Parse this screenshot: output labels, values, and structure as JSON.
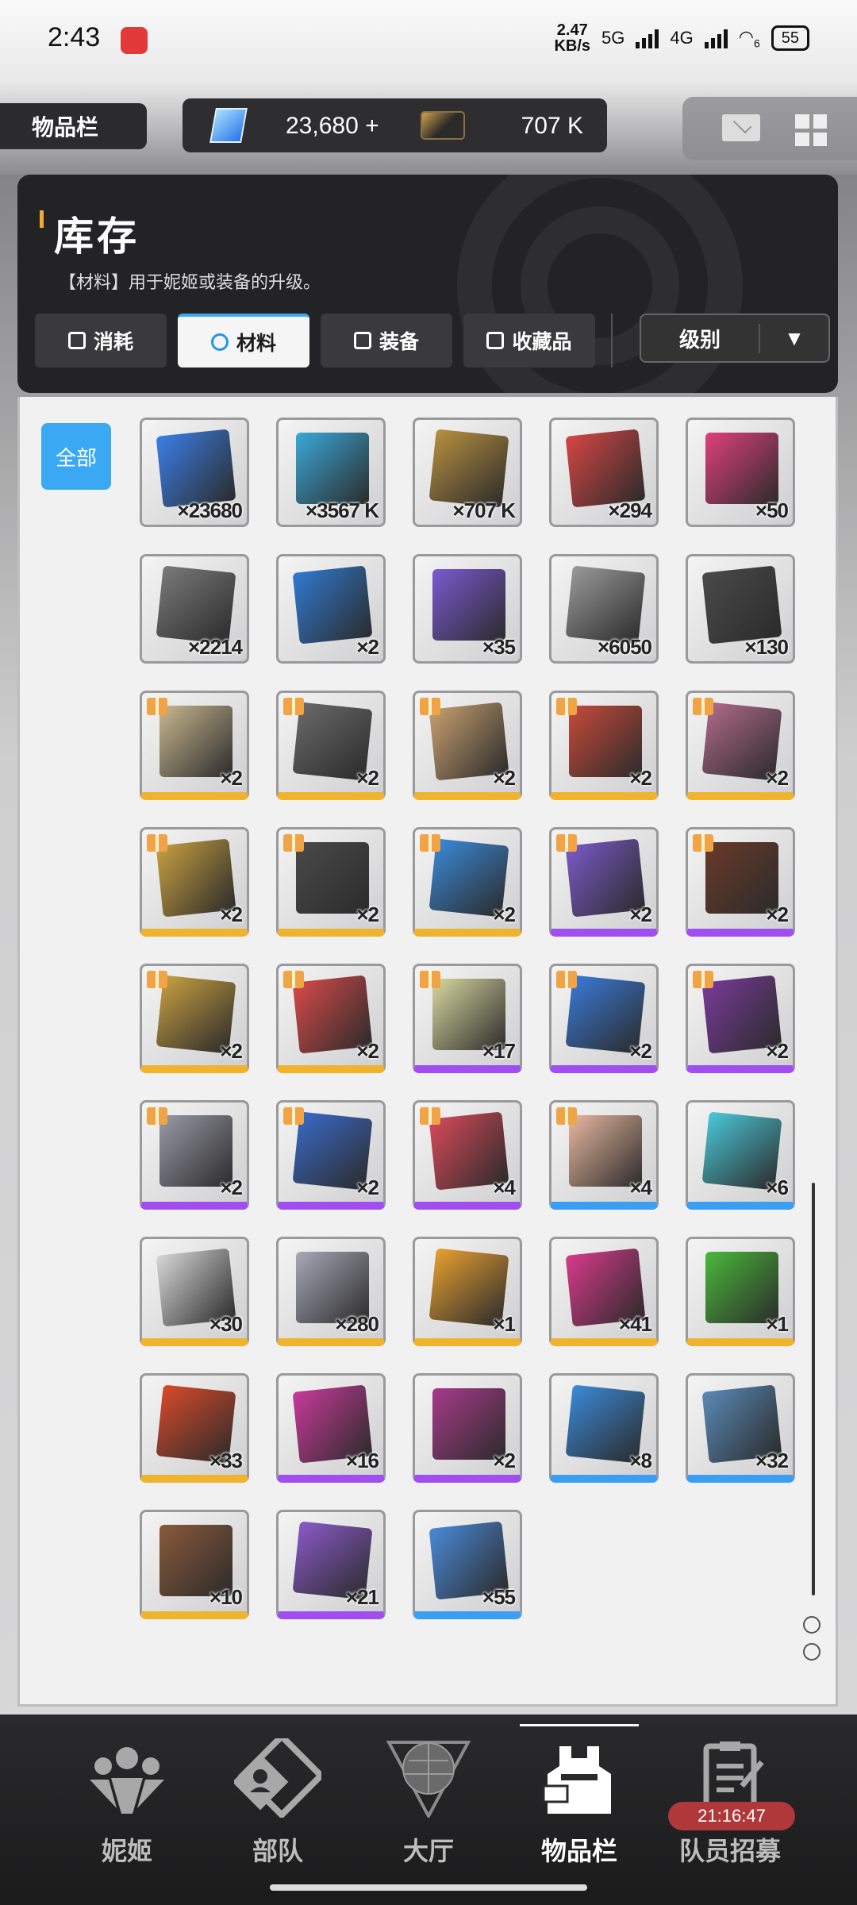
{
  "status_bar": {
    "time": "2:43",
    "speed": "2.47",
    "speed_unit": "KB/s",
    "net1": "5G",
    "net2": "4G",
    "wifi_label": "6",
    "battery": "55"
  },
  "header": {
    "page_tab": "物品栏",
    "currency": {
      "gems": "23,680",
      "gems_add": "+",
      "credits": "707 K"
    },
    "icons": [
      "mail-icon",
      "grid-menu-icon"
    ]
  },
  "panel": {
    "title": "库存",
    "description": "【材料】用于妮姬或装备的升级。",
    "tabs": [
      {
        "label": "消耗",
        "icon": "consumable-icon"
      },
      {
        "label": "材料",
        "icon": "material-icon"
      },
      {
        "label": "装备",
        "icon": "equipment-icon"
      },
      {
        "label": "收藏品",
        "icon": "collection-icon"
      }
    ],
    "active_tab": "材料",
    "sort_label": "级别",
    "sort_arrow": "▼"
  },
  "filter": {
    "all_label": "全部"
  },
  "items": [
    {
      "name": "gem-crystal",
      "count": "×23680",
      "rarity": "none",
      "gift": false,
      "color": "#3a7fe8"
    },
    {
      "name": "usb-drive",
      "count": "×3567 K",
      "rarity": "none",
      "gift": false,
      "color": "#3aa8d8"
    },
    {
      "name": "credit-card",
      "count": "×707 K",
      "rarity": "none",
      "gift": false,
      "color": "#b89040"
    },
    {
      "name": "core-orb",
      "count": "×294",
      "rarity": "none",
      "gift": false,
      "color": "#d64545"
    },
    {
      "name": "heart-gem",
      "count": "×50",
      "rarity": "none",
      "gift": false,
      "color": "#e0407a"
    },
    {
      "name": "ticket",
      "count": "×2214",
      "rarity": "none",
      "gift": false,
      "color": "#7a7a7a"
    },
    {
      "name": "photo-card-blue",
      "count": "×2",
      "rarity": "none",
      "gift": false,
      "color": "#2f7ad0"
    },
    {
      "name": "photo-card-rainbow",
      "count": "×35",
      "rarity": "none",
      "gift": false,
      "color": "#7a5ad0"
    },
    {
      "name": "dna-badge",
      "count": "×6050",
      "rarity": "none",
      "gift": false,
      "color": "#9a9a9a"
    },
    {
      "name": "wing-card",
      "count": "×130",
      "rarity": "none",
      "gift": false,
      "color": "#4a4a4a"
    },
    {
      "name": "old-paper",
      "count": "×2",
      "rarity": "orange",
      "gift": true,
      "color": "#c9b890"
    },
    {
      "name": "battery",
      "count": "×2",
      "rarity": "orange",
      "gift": true,
      "color": "#6a6a6a"
    },
    {
      "name": "retort-food",
      "count": "×2",
      "rarity": "orange",
      "gift": true,
      "color": "#c8a070"
    },
    {
      "name": "toy-train",
      "count": "×2",
      "rarity": "orange",
      "gift": true,
      "color": "#c84a3a"
    },
    {
      "name": "art-book",
      "count": "×2",
      "rarity": "orange",
      "gift": true,
      "color": "#b06a8a"
    },
    {
      "name": "police-badge",
      "count": "×2",
      "rarity": "orange",
      "gift": true,
      "color": "#c8a040"
    },
    {
      "name": "walkie-talkie",
      "count": "×2",
      "rarity": "orange",
      "gift": true,
      "color": "#4a4a4a"
    },
    {
      "name": "water-bottles",
      "count": "×2",
      "rarity": "orange",
      "gift": true,
      "color": "#3a8ad8"
    },
    {
      "name": "ticket-purple",
      "count": "×2",
      "rarity": "purple",
      "gift": true,
      "color": "#7a5ac8"
    },
    {
      "name": "vip-beauty-card",
      "count": "×2",
      "rarity": "purple",
      "gift": true,
      "color": "#6a3a2a"
    },
    {
      "name": "vip-card-gold",
      "count": "×2",
      "rarity": "orange",
      "gift": true,
      "color": "#c8a040"
    },
    {
      "name": "red-ticket",
      "count": "×2",
      "rarity": "orange",
      "gift": true,
      "color": "#d84a4a"
    },
    {
      "name": "lottery-ticket",
      "count": "×17",
      "rarity": "purple",
      "gift": true,
      "color": "#d8d8a0"
    },
    {
      "name": "blue-pass",
      "count": "×2",
      "rarity": "purple",
      "gift": true,
      "color": "#3a7ad8"
    },
    {
      "name": "hair-shop-card",
      "count": "×2",
      "rarity": "purple",
      "gift": true,
      "color": "#7a3a9a"
    },
    {
      "name": "silver-card",
      "count": "×2",
      "rarity": "purple",
      "gift": true,
      "color": "#9a9aa8"
    },
    {
      "name": "id-card",
      "count": "×2",
      "rarity": "purple",
      "gift": true,
      "color": "#3a6ac8"
    },
    {
      "name": "red-coupon",
      "count": "×4",
      "rarity": "purple",
      "gift": true,
      "color": "#d84a5a"
    },
    {
      "name": "gift-coupon",
      "count": "×4",
      "rarity": "blue",
      "gift": true,
      "color": "#e8b8a0"
    },
    {
      "name": "hex-emblem",
      "count": "×6",
      "rarity": "blue",
      "gift": false,
      "color": "#4ac8d8"
    },
    {
      "name": "signed-photo",
      "count": "×30",
      "rarity": "orange",
      "gift": false,
      "color": "#d8d8d8"
    },
    {
      "name": "crystal-drop",
      "count": "×280",
      "rarity": "orange",
      "gift": false,
      "color": "#a8a8b8"
    },
    {
      "name": "module-orange",
      "count": "×1",
      "rarity": "orange",
      "gift": false,
      "color": "#e8a030"
    },
    {
      "name": "module-pink",
      "count": "×41",
      "rarity": "orange",
      "gift": false,
      "color": "#d83a8a"
    },
    {
      "name": "module-green",
      "count": "×1",
      "rarity": "orange",
      "gift": false,
      "color": "#4ab83a"
    },
    {
      "name": "module-red",
      "count": "×33",
      "rarity": "orange",
      "gift": false,
      "color": "#d84a2a"
    },
    {
      "name": "module-magenta",
      "count": "×16",
      "rarity": "purple",
      "gift": false,
      "color": "#c83a9a"
    },
    {
      "name": "module-purple",
      "count": "×2",
      "rarity": "purple",
      "gift": false,
      "color": "#a83a8a"
    },
    {
      "name": "module-blue",
      "count": "×8",
      "rarity": "blue",
      "gift": false,
      "color": "#3a8ad8"
    },
    {
      "name": "module-steel",
      "count": "×32",
      "rarity": "blue",
      "gift": false,
      "color": "#5a8ab8"
    },
    {
      "name": "toolbox-orange",
      "count": "×10",
      "rarity": "orange",
      "gift": false,
      "color": "#8a5a3a"
    },
    {
      "name": "toolbox-purple",
      "count": "×21",
      "rarity": "purple",
      "gift": false,
      "color": "#8a5ac8"
    },
    {
      "name": "toolbox-blue",
      "count": "×55",
      "rarity": "blue",
      "gift": false,
      "color": "#4a8ad8"
    }
  ],
  "bottom_nav": [
    {
      "label": "妮姬",
      "icon": "nikke-group-icon"
    },
    {
      "label": "部队",
      "icon": "squad-icon"
    },
    {
      "label": "大厅",
      "icon": "lobby-icon"
    },
    {
      "label": "物品栏",
      "icon": "inventory-icon"
    },
    {
      "label": "队员招募",
      "icon": "recruit-icon"
    }
  ],
  "active_nav": "物品栏",
  "recruit_timer": "21:16:47",
  "colors": {
    "accent_blue": "#3ba8f4",
    "rarity_orange": "#f0b32e",
    "rarity_purple": "#a04ef0",
    "rarity_blue": "#3a9ef2"
  }
}
